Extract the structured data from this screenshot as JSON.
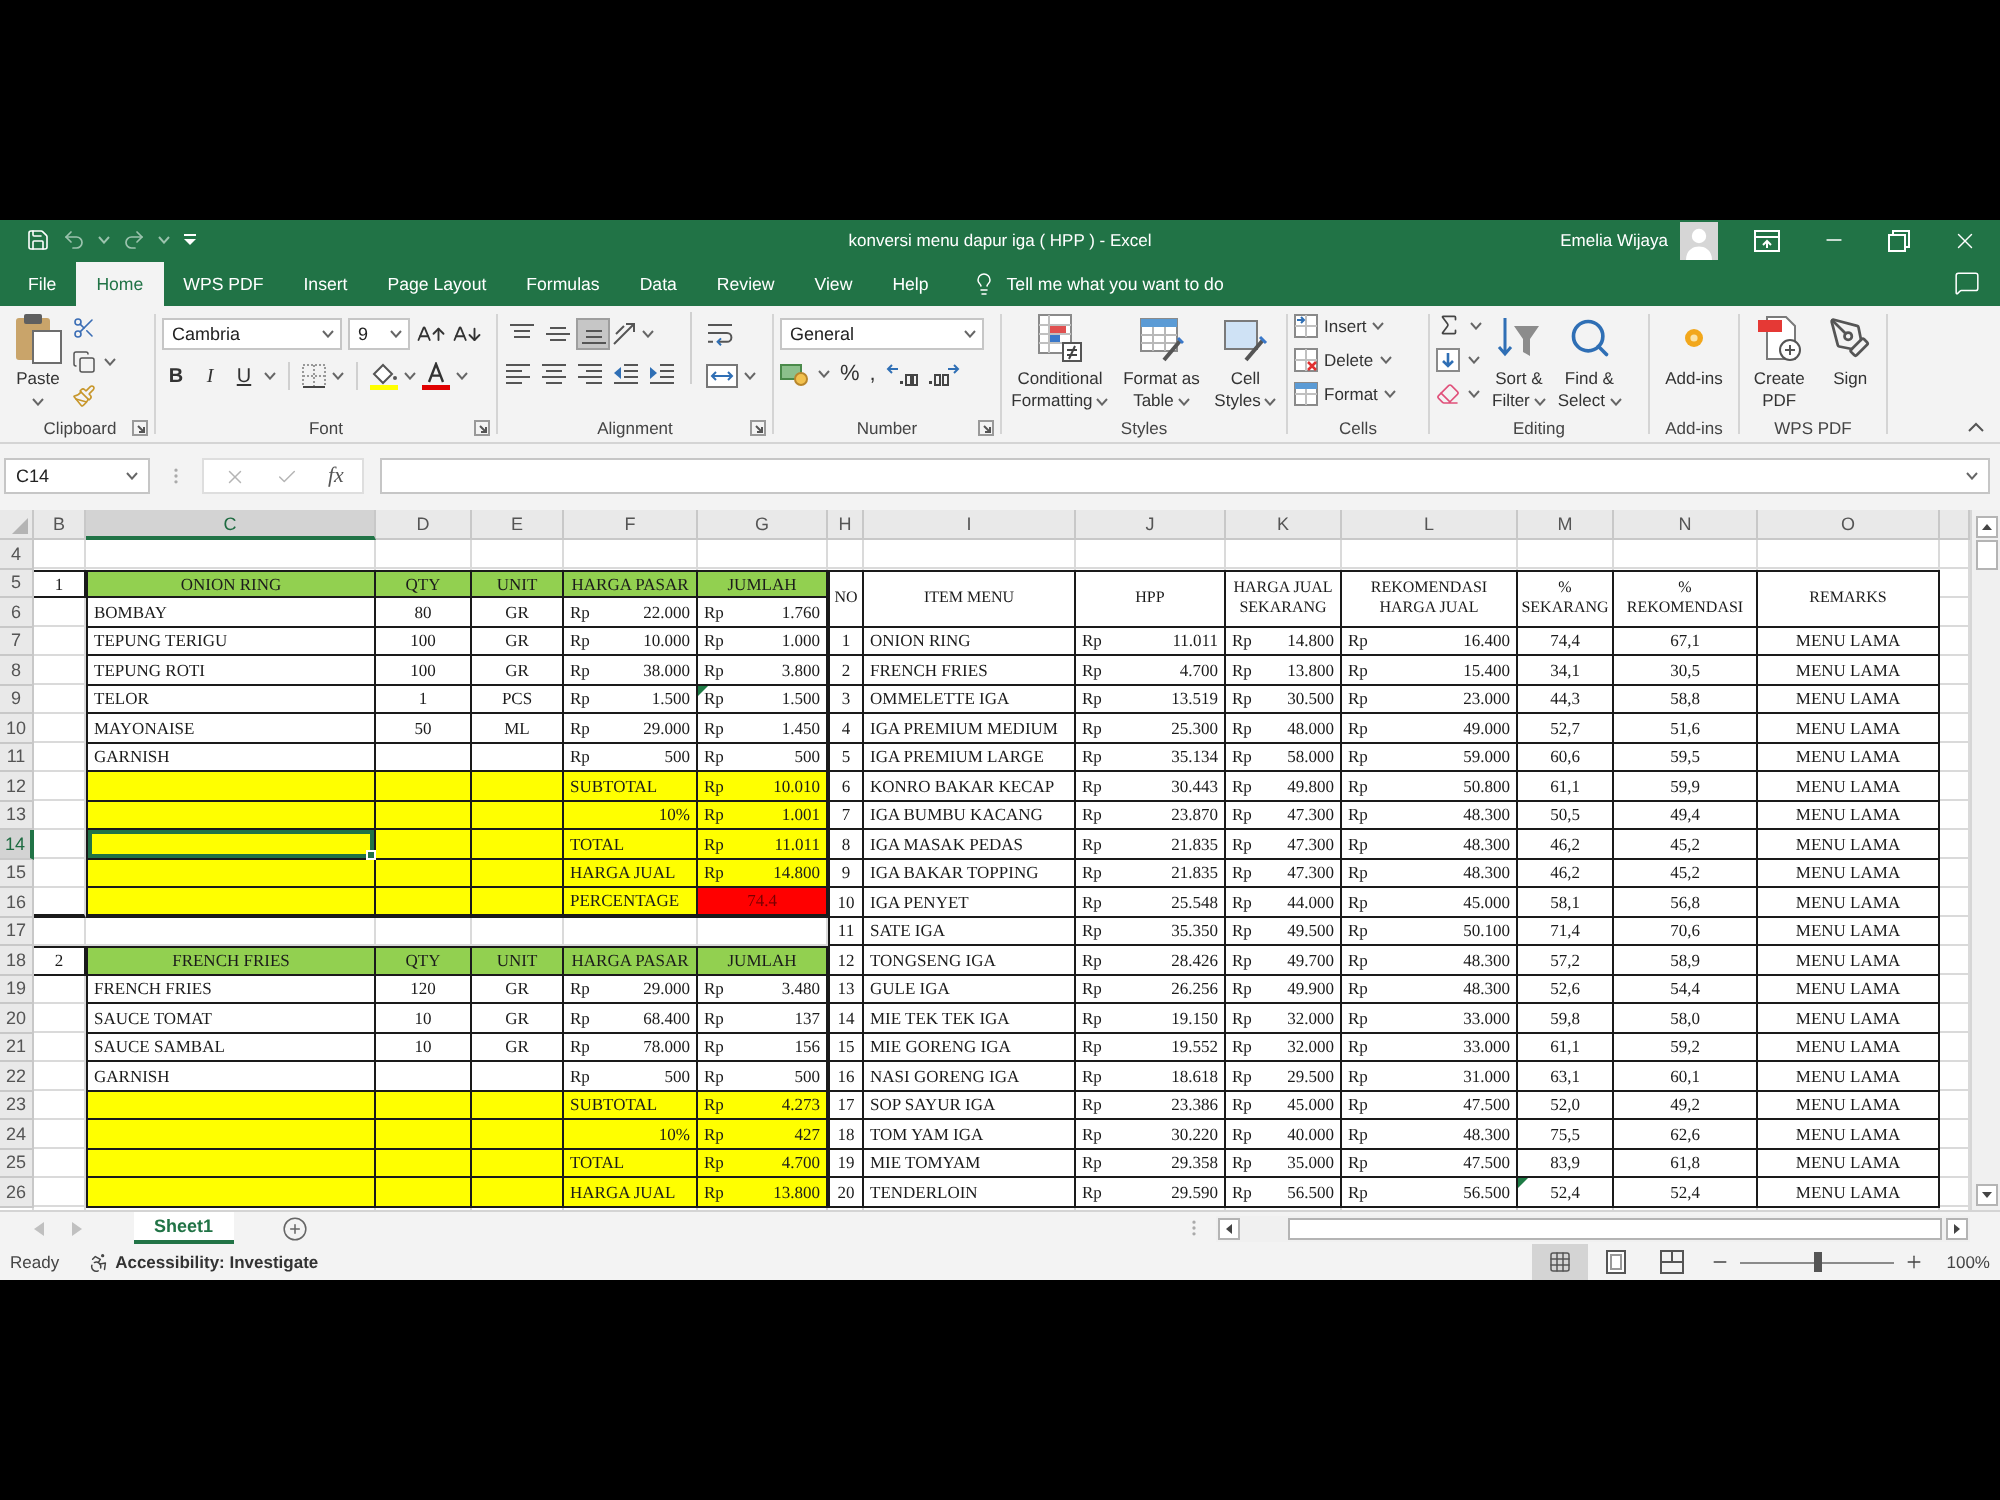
{
  "window": {
    "title": "konversi menu dapur iga ( HPP ) - Excel",
    "user": "Emelia Wijaya"
  },
  "ribbon_tabs": [
    {
      "label": "File",
      "selected": false
    },
    {
      "label": "Home",
      "selected": true
    },
    {
      "label": "WPS PDF",
      "selected": false
    },
    {
      "label": "Insert",
      "selected": false
    },
    {
      "label": "Page Layout",
      "selected": false
    },
    {
      "label": "Formulas",
      "selected": false
    },
    {
      "label": "Data",
      "selected": false
    },
    {
      "label": "Review",
      "selected": false
    },
    {
      "label": "View",
      "selected": false
    },
    {
      "label": "Help",
      "selected": false
    }
  ],
  "tell_me": "Tell me what you want to do",
  "ribbon": {
    "groups": [
      {
        "kind": "clipboard",
        "label": "Clipboard",
        "paste": "Paste"
      },
      {
        "kind": "font",
        "label": "Font",
        "font_name": "Cambria",
        "font_size": "9",
        "style_buttons": [
          "B",
          "I",
          "U"
        ]
      },
      {
        "kind": "alignment",
        "label": "Alignment",
        "vertical_align": [
          {
            "kind": "top",
            "selected": false
          },
          {
            "kind": "middle",
            "selected": false
          },
          {
            "kind": "bottom",
            "selected": true
          }
        ]
      },
      {
        "kind": "number",
        "label": "Number",
        "format": "General",
        "symbols": [
          "%",
          ","
        ]
      },
      {
        "kind": "styles",
        "label": "Styles",
        "buttons": [
          {
            "kind": "conditional_formatting",
            "lines": [
              "Conditional",
              "Formatting"
            ]
          },
          {
            "kind": "format_as_table",
            "lines": [
              "Format as",
              "Table"
            ]
          },
          {
            "kind": "cell_styles",
            "lines": [
              "Cell",
              "Styles"
            ]
          }
        ]
      },
      {
        "kind": "cells",
        "label": "Cells",
        "buttons": [
          {
            "kind": "insert",
            "label": "Insert"
          },
          {
            "kind": "delete",
            "label": "Delete"
          },
          {
            "kind": "format",
            "label": "Format"
          }
        ]
      },
      {
        "kind": "editing",
        "label": "Editing",
        "buttons": [
          {
            "kind": "sort_filter",
            "lines": [
              "Sort &",
              "Filter"
            ]
          },
          {
            "kind": "find_select",
            "lines": [
              "Find &",
              "Select"
            ]
          }
        ]
      },
      {
        "kind": "add_ins",
        "label": "Add-ins",
        "buttons": [
          {
            "kind": "add_ins",
            "lines": [
              "Add-ins"
            ]
          }
        ]
      },
      {
        "kind": "wps_pdf",
        "label": "WPS PDF",
        "buttons": [
          {
            "kind": "create_pdf",
            "lines": [
              "Create",
              "PDF"
            ]
          },
          {
            "kind": "sign",
            "lines": [
              "Sign"
            ]
          }
        ]
      }
    ]
  },
  "formula_bar": {
    "name_box": "C14",
    "function_label": "fx"
  },
  "sheet": {
    "columns": [
      {
        "label": "B",
        "selected": false
      },
      {
        "label": "C",
        "selected": true
      },
      {
        "label": "D",
        "selected": false
      },
      {
        "label": "E",
        "selected": false
      },
      {
        "label": "F",
        "selected": false
      },
      {
        "label": "G",
        "selected": false
      },
      {
        "label": "H",
        "selected": false
      },
      {
        "label": "I",
        "selected": false
      },
      {
        "label": "J",
        "selected": false
      },
      {
        "label": "K",
        "selected": false
      },
      {
        "label": "L",
        "selected": false
      },
      {
        "label": "M",
        "selected": false
      },
      {
        "label": "N",
        "selected": false
      },
      {
        "label": "O",
        "selected": false
      }
    ],
    "rows": [
      {
        "label": "4",
        "selected": false
      },
      {
        "label": "5",
        "selected": false
      },
      {
        "label": "6",
        "selected": false
      },
      {
        "label": "7",
        "selected": false
      },
      {
        "label": "8",
        "selected": false
      },
      {
        "label": "9",
        "selected": false
      },
      {
        "label": "10",
        "selected": false
      },
      {
        "label": "11",
        "selected": false
      },
      {
        "label": "12",
        "selected": false
      },
      {
        "label": "13",
        "selected": false
      },
      {
        "label": "14",
        "selected": true
      },
      {
        "label": "15",
        "selected": false
      },
      {
        "label": "16",
        "selected": false
      },
      {
        "label": "17",
        "selected": false
      },
      {
        "label": "18",
        "selected": false
      },
      {
        "label": "19",
        "selected": false
      },
      {
        "label": "20",
        "selected": false
      },
      {
        "label": "21",
        "selected": false
      },
      {
        "label": "22",
        "selected": false
      },
      {
        "label": "23",
        "selected": false
      },
      {
        "label": "24",
        "selected": false
      },
      {
        "label": "25",
        "selected": false
      },
      {
        "label": "26",
        "selected": false
      }
    ],
    "recipes": [
      {
        "number": "1",
        "title": "ONION RING",
        "headers": [
          "QTY",
          "UNIT",
          "HARGA PASAR",
          "JUMLAH"
        ],
        "ingredients": [
          {
            "name": "BOMBAY",
            "qty": "80",
            "unit": "GR",
            "price": {
              "currency": "Rp",
              "value": "22.000"
            },
            "amount": {
              "currency": "Rp",
              "value": "1.760"
            },
            "flagged": false
          },
          {
            "name": "TEPUNG TERIGU",
            "qty": "100",
            "unit": "GR",
            "price": {
              "currency": "Rp",
              "value": "10.000"
            },
            "amount": {
              "currency": "Rp",
              "value": "1.000"
            },
            "flagged": false
          },
          {
            "name": "TEPUNG ROTI",
            "qty": "100",
            "unit": "GR",
            "price": {
              "currency": "Rp",
              "value": "38.000"
            },
            "amount": {
              "currency": "Rp",
              "value": "3.800"
            },
            "flagged": false
          },
          {
            "name": "TELOR",
            "qty": "1",
            "unit": "PCS",
            "price": {
              "currency": "Rp",
              "value": "1.500"
            },
            "amount": {
              "currency": "Rp",
              "value": "1.500"
            },
            "flagged": true
          },
          {
            "name": "MAYONAISE",
            "qty": "50",
            "unit": "ML",
            "price": {
              "currency": "Rp",
              "value": "29.000"
            },
            "amount": {
              "currency": "Rp",
              "value": "1.450"
            },
            "flagged": false
          },
          {
            "name": "GARNISH",
            "price": {
              "currency": "Rp",
              "value": "500"
            },
            "amount": {
              "currency": "Rp",
              "value": "500"
            },
            "flagged": false
          }
        ],
        "summary": [
          {
            "kind": "subtotal",
            "label": "SUBTOTAL",
            "amount": {
              "currency": "Rp",
              "value": "10.010"
            }
          },
          {
            "kind": "rate",
            "label": "10%",
            "amount": {
              "currency": "Rp",
              "value": "1.001"
            }
          },
          {
            "kind": "total",
            "label": "TOTAL",
            "amount": {
              "currency": "Rp",
              "value": "11.011"
            }
          },
          {
            "kind": "price",
            "label": "HARGA JUAL",
            "amount": {
              "currency": "Rp",
              "value": "14.800"
            }
          },
          {
            "kind": "percentage",
            "label": "PERCENTAGE",
            "value": "74.4"
          }
        ]
      },
      {
        "number": "2",
        "title": "FRENCH FRIES",
        "headers": [
          "QTY",
          "UNIT",
          "HARGA PASAR",
          "JUMLAH"
        ],
        "ingredients": [
          {
            "name": "FRENCH FRIES",
            "qty": "120",
            "unit": "GR",
            "price": {
              "currency": "Rp",
              "value": "29.000"
            },
            "amount": {
              "currency": "Rp",
              "value": "3.480"
            },
            "flagged": false
          },
          {
            "name": "SAUCE TOMAT",
            "qty": "10",
            "unit": "GR",
            "price": {
              "currency": "Rp",
              "value": "68.400"
            },
            "amount": {
              "currency": "Rp",
              "value": "137"
            },
            "flagged": false
          },
          {
            "name": "SAUCE SAMBAL",
            "qty": "10",
            "unit": "GR",
            "price": {
              "currency": "Rp",
              "value": "78.000"
            },
            "amount": {
              "currency": "Rp",
              "value": "156"
            },
            "flagged": false
          },
          {
            "name": "GARNISH",
            "price": {
              "currency": "Rp",
              "value": "500"
            },
            "amount": {
              "currency": "Rp",
              "value": "500"
            },
            "flagged": false
          }
        ],
        "summary": [
          {
            "kind": "subtotal",
            "label": "SUBTOTAL",
            "amount": {
              "currency": "Rp",
              "value": "4.273"
            }
          },
          {
            "kind": "rate",
            "label": "10%",
            "amount": {
              "currency": "Rp",
              "value": "427"
            }
          },
          {
            "kind": "total",
            "label": "TOTAL",
            "amount": {
              "currency": "Rp",
              "value": "4.700"
            }
          },
          {
            "kind": "price",
            "label": "HARGA JUAL",
            "amount": {
              "currency": "Rp",
              "value": "13.800"
            }
          }
        ]
      }
    ],
    "menu_table": {
      "headers": [
        [
          "NO"
        ],
        [
          "ITEM MENU"
        ],
        [
          "HPP"
        ],
        [
          "HARGA JUAL",
          "SEKARANG"
        ],
        [
          "REKOMENDASI",
          "HARGA JUAL"
        ],
        [
          "%",
          "SEKARANG"
        ],
        [
          "%",
          "REKOMENDASI"
        ],
        [
          "REMARKS"
        ]
      ],
      "rows": [
        {
          "no": "1",
          "item": "ONION RING",
          "hpp": {
            "currency": "Rp",
            "value": "11.011"
          },
          "current_price": {
            "currency": "Rp",
            "value": "14.800"
          },
          "recommended_price": {
            "currency": "Rp",
            "value": "16.400"
          },
          "current_pct": "74,4",
          "recommended_pct": "67,1",
          "remarks": "MENU LAMA",
          "flagged": false
        },
        {
          "no": "2",
          "item": "FRENCH FRIES",
          "hpp": {
            "currency": "Rp",
            "value": "4.700"
          },
          "current_price": {
            "currency": "Rp",
            "value": "13.800"
          },
          "recommended_price": {
            "currency": "Rp",
            "value": "15.400"
          },
          "current_pct": "34,1",
          "recommended_pct": "30,5",
          "remarks": "MENU LAMA",
          "flagged": false
        },
        {
          "no": "3",
          "item": "OMMELETTE IGA",
          "hpp": {
            "currency": "Rp",
            "value": "13.519"
          },
          "current_price": {
            "currency": "Rp",
            "value": "30.500"
          },
          "recommended_price": {
            "currency": "Rp",
            "value": "23.000"
          },
          "current_pct": "44,3",
          "recommended_pct": "58,8",
          "remarks": "MENU LAMA",
          "flagged": false
        },
        {
          "no": "4",
          "item": "IGA PREMIUM MEDIUM",
          "hpp": {
            "currency": "Rp",
            "value": "25.300"
          },
          "current_price": {
            "currency": "Rp",
            "value": "48.000"
          },
          "recommended_price": {
            "currency": "Rp",
            "value": "49.000"
          },
          "current_pct": "52,7",
          "recommended_pct": "51,6",
          "remarks": "MENU LAMA",
          "flagged": false
        },
        {
          "no": "5",
          "item": "IGA PREMIUM LARGE",
          "hpp": {
            "currency": "Rp",
            "value": "35.134"
          },
          "current_price": {
            "currency": "Rp",
            "value": "58.000"
          },
          "recommended_price": {
            "currency": "Rp",
            "value": "59.000"
          },
          "current_pct": "60,6",
          "recommended_pct": "59,5",
          "remarks": "MENU LAMA",
          "flagged": false
        },
        {
          "no": "6",
          "item": "KONRO BAKAR KECAP",
          "hpp": {
            "currency": "Rp",
            "value": "30.443"
          },
          "current_price": {
            "currency": "Rp",
            "value": "49.800"
          },
          "recommended_price": {
            "currency": "Rp",
            "value": "50.800"
          },
          "current_pct": "61,1",
          "recommended_pct": "59,9",
          "remarks": "MENU LAMA",
          "flagged": false
        },
        {
          "no": "7",
          "item": "IGA BUMBU KACANG",
          "hpp": {
            "currency": "Rp",
            "value": "23.870"
          },
          "current_price": {
            "currency": "Rp",
            "value": "47.300"
          },
          "recommended_price": {
            "currency": "Rp",
            "value": "48.300"
          },
          "current_pct": "50,5",
          "recommended_pct": "49,4",
          "remarks": "MENU LAMA",
          "flagged": false
        },
        {
          "no": "8",
          "item": "IGA MASAK PEDAS",
          "hpp": {
            "currency": "Rp",
            "value": "21.835"
          },
          "current_price": {
            "currency": "Rp",
            "value": "47.300"
          },
          "recommended_price": {
            "currency": "Rp",
            "value": "48.300"
          },
          "current_pct": "46,2",
          "recommended_pct": "45,2",
          "remarks": "MENU LAMA",
          "flagged": false
        },
        {
          "no": "9",
          "item": "IGA BAKAR TOPPING",
          "hpp": {
            "currency": "Rp",
            "value": "21.835"
          },
          "current_price": {
            "currency": "Rp",
            "value": "47.300"
          },
          "recommended_price": {
            "currency": "Rp",
            "value": "48.300"
          },
          "current_pct": "46,2",
          "recommended_pct": "45,2",
          "remarks": "MENU LAMA",
          "flagged": false
        },
        {
          "no": "10",
          "item": "IGA PENYET",
          "hpp": {
            "currency": "Rp",
            "value": "25.548"
          },
          "current_price": {
            "currency": "Rp",
            "value": "44.000"
          },
          "recommended_price": {
            "currency": "Rp",
            "value": "45.000"
          },
          "current_pct": "58,1",
          "recommended_pct": "56,8",
          "remarks": "MENU LAMA",
          "flagged": false
        },
        {
          "no": "11",
          "item": "SATE IGA",
          "hpp": {
            "currency": "Rp",
            "value": "35.350"
          },
          "current_price": {
            "currency": "Rp",
            "value": "49.500"
          },
          "recommended_price": {
            "currency": "Rp",
            "value": "50.100"
          },
          "current_pct": "71,4",
          "recommended_pct": "70,6",
          "remarks": "MENU LAMA",
          "flagged": false
        },
        {
          "no": "12",
          "item": "TONGSENG IGA",
          "hpp": {
            "currency": "Rp",
            "value": "28.426"
          },
          "current_price": {
            "currency": "Rp",
            "value": "49.700"
          },
          "recommended_price": {
            "currency": "Rp",
            "value": "48.300"
          },
          "current_pct": "57,2",
          "recommended_pct": "58,9",
          "remarks": "MENU LAMA",
          "flagged": false
        },
        {
          "no": "13",
          "item": "GULE IGA",
          "hpp": {
            "currency": "Rp",
            "value": "26.256"
          },
          "current_price": {
            "currency": "Rp",
            "value": "49.900"
          },
          "recommended_price": {
            "currency": "Rp",
            "value": "48.300"
          },
          "current_pct": "52,6",
          "recommended_pct": "54,4",
          "remarks": "MENU LAMA",
          "flagged": false
        },
        {
          "no": "14",
          "item": "MIE TEK TEK IGA",
          "hpp": {
            "currency": "Rp",
            "value": "19.150"
          },
          "current_price": {
            "currency": "Rp",
            "value": "32.000"
          },
          "recommended_price": {
            "currency": "Rp",
            "value": "33.000"
          },
          "current_pct": "59,8",
          "recommended_pct": "58,0",
          "remarks": "MENU LAMA",
          "flagged": false
        },
        {
          "no": "15",
          "item": "MIE GORENG IGA",
          "hpp": {
            "currency": "Rp",
            "value": "19.552"
          },
          "current_price": {
            "currency": "Rp",
            "value": "32.000"
          },
          "recommended_price": {
            "currency": "Rp",
            "value": "33.000"
          },
          "current_pct": "61,1",
          "recommended_pct": "59,2",
          "remarks": "MENU LAMA",
          "flagged": false
        },
        {
          "no": "16",
          "item": "NASI GORENG IGA",
          "hpp": {
            "currency": "Rp",
            "value": "18.618"
          },
          "current_price": {
            "currency": "Rp",
            "value": "29.500"
          },
          "recommended_price": {
            "currency": "Rp",
            "value": "31.000"
          },
          "current_pct": "63,1",
          "recommended_pct": "60,1",
          "remarks": "MENU LAMA",
          "flagged": false
        },
        {
          "no": "17",
          "item": "SOP SAYUR IGA",
          "hpp": {
            "currency": "Rp",
            "value": "23.386"
          },
          "current_price": {
            "currency": "Rp",
            "value": "45.000"
          },
          "recommended_price": {
            "currency": "Rp",
            "value": "47.500"
          },
          "current_pct": "52,0",
          "recommended_pct": "49,2",
          "remarks": "MENU LAMA",
          "flagged": false
        },
        {
          "no": "18",
          "item": "TOM YAM IGA",
          "hpp": {
            "currency": "Rp",
            "value": "30.220"
          },
          "current_price": {
            "currency": "Rp",
            "value": "40.000"
          },
          "recommended_price": {
            "currency": "Rp",
            "value": "48.300"
          },
          "current_pct": "75,5",
          "recommended_pct": "62,6",
          "remarks": "MENU LAMA",
          "flagged": false
        },
        {
          "no": "19",
          "item": "MIE TOMYAM",
          "hpp": {
            "currency": "Rp",
            "value": "29.358"
          },
          "current_price": {
            "currency": "Rp",
            "value": "35.000"
          },
          "recommended_price": {
            "currency": "Rp",
            "value": "47.500"
          },
          "current_pct": "83,9",
          "recommended_pct": "61,8",
          "remarks": "MENU LAMA",
          "flagged": false
        },
        {
          "no": "20",
          "item": "TENDERLOIN",
          "hpp": {
            "currency": "Rp",
            "value": "29.590"
          },
          "current_price": {
            "currency": "Rp",
            "value": "56.500"
          },
          "recommended_price": {
            "currency": "Rp",
            "value": "56.500"
          },
          "current_pct": "52,4",
          "recommended_pct": "52,4",
          "remarks": "MENU LAMA",
          "flagged": true
        }
      ]
    }
  },
  "sheet_tabs": [
    {
      "label": "Sheet1",
      "selected": true
    }
  ],
  "status_bar": {
    "status": "Ready",
    "accessibility": "Accessibility: Investigate",
    "views": [
      {
        "kind": "normal",
        "selected": true
      },
      {
        "kind": "page_layout",
        "selected": false
      },
      {
        "kind": "page_break",
        "selected": false
      }
    ],
    "zoom": {
      "level": 0.5,
      "reading": "100%"
    }
  }
}
